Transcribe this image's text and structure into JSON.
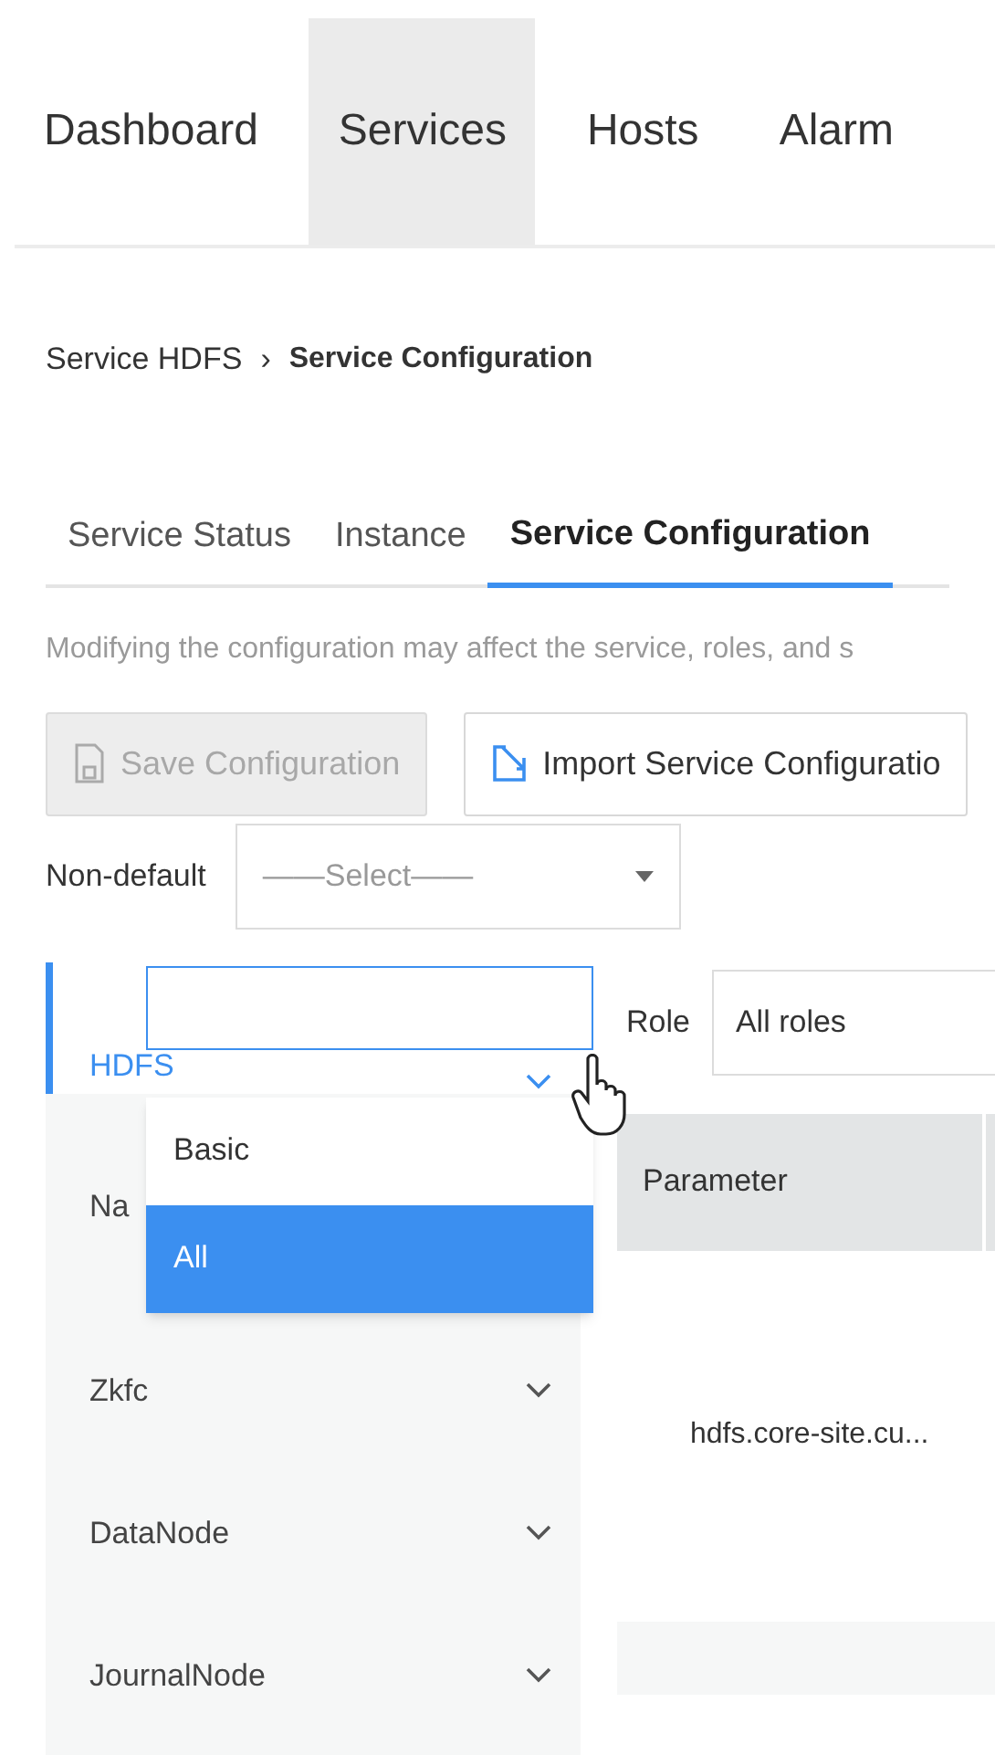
{
  "top_nav": [
    {
      "label": "Dashboard",
      "selected": false
    },
    {
      "label": "Services",
      "selected": true
    },
    {
      "label": "Hosts",
      "selected": false
    },
    {
      "label": "Alarm",
      "selected": false
    }
  ],
  "breadcrumb": {
    "parent": "Service HDFS",
    "separator": "›",
    "current": "Service Configuration"
  },
  "sub_tabs": [
    {
      "label": "Service Status",
      "selected": false
    },
    {
      "label": "Instance",
      "selected": false
    },
    {
      "label": "Service Configuration",
      "selected": true
    }
  ],
  "notice": "Modifying the configuration may affect the service, roles, and s",
  "buttons": [
    {
      "label": "Save Configuration",
      "disabled": true
    },
    {
      "label": "Import Service Configuratio",
      "disabled": false
    }
  ],
  "non_default": {
    "label": "Non-default",
    "placeholder": "——Select——"
  },
  "nav_items": [
    {
      "label": "HDFS",
      "selected": true
    },
    {
      "label": "Na",
      "selected": false
    },
    {
      "label": "Zkfc",
      "selected": false
    },
    {
      "label": "DataNode",
      "selected": false
    },
    {
      "label": "JournalNode",
      "selected": false
    }
  ],
  "view_dropdown": {
    "expanded": true,
    "options": [
      {
        "label": "Basic",
        "selected": false
      },
      {
        "label": "All",
        "selected": true
      }
    ]
  },
  "role": {
    "label": "Role",
    "value": "All roles"
  },
  "table": {
    "columns": [
      "Parameter"
    ],
    "rows": [
      [
        "hdfs.core-site.cu..."
      ]
    ]
  }
}
